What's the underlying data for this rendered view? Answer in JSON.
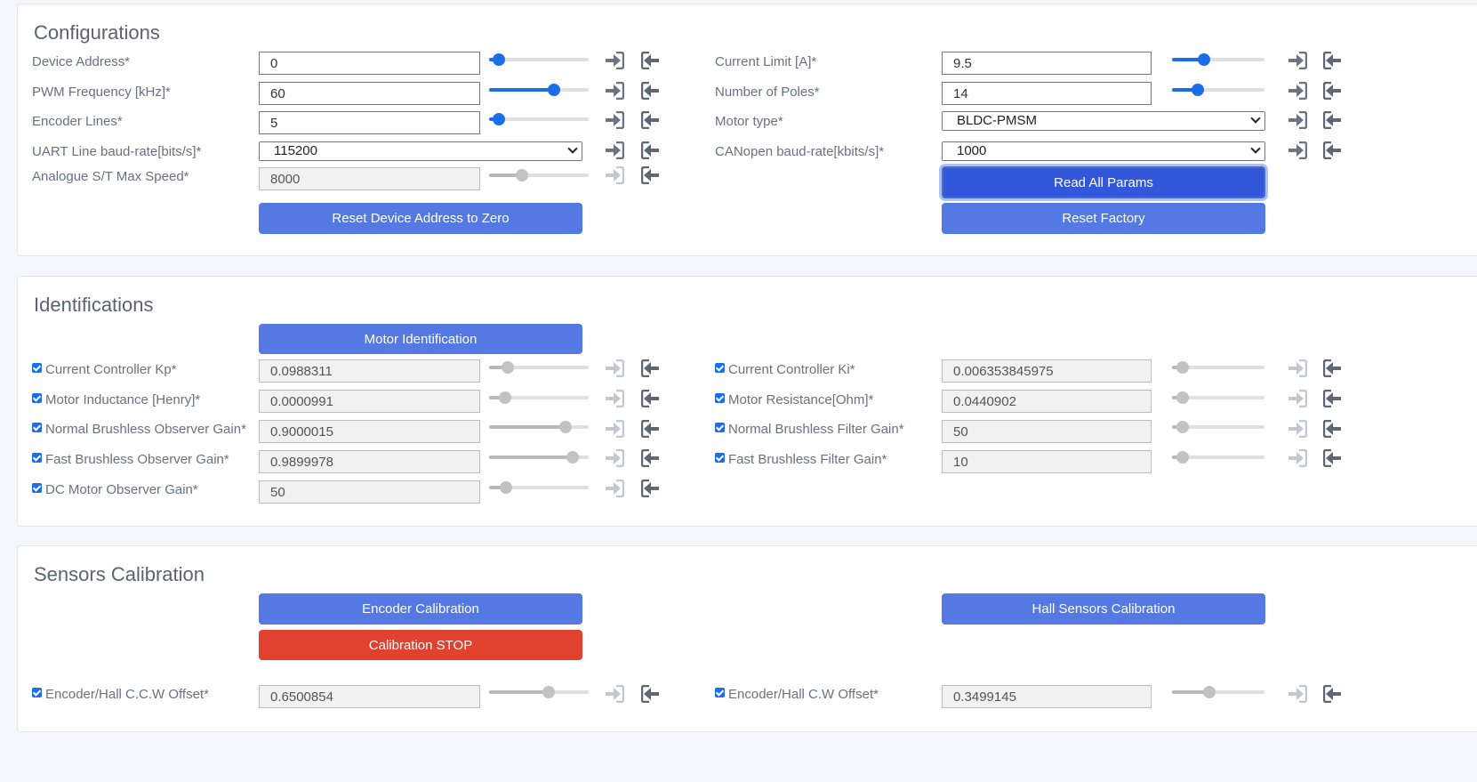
{
  "configurations": {
    "title": "Configurations",
    "device_address": {
      "label": "Device Address*",
      "value": "0",
      "slider": 0.1
    },
    "pwm_frequency": {
      "label": "PWM Frequency [kHz]*",
      "value": "60",
      "slider": 0.65
    },
    "encoder_lines": {
      "label": "Encoder Lines*",
      "value": "5",
      "slider": 0.1
    },
    "uart_baud": {
      "label": "UART Line baud-rate[bits/s]*",
      "value": "115200"
    },
    "analogue_max_speed": {
      "label": "Analogue S/T Max Speed*",
      "value": "8000",
      "slider": 0.33
    },
    "current_limit": {
      "label": "Current Limit [A]*",
      "value": "9.5",
      "slider": 0.35
    },
    "number_of_poles": {
      "label": "Number of Poles*",
      "value": "14",
      "slider": 0.28
    },
    "motor_type": {
      "label": "Motor type*",
      "value": "BLDC-PMSM"
    },
    "canopen_baud": {
      "label": "CANopen baud-rate[kbits/s]*",
      "value": "1000"
    },
    "reset_device_address_label": "Reset Device Address to Zero",
    "read_all_params_label": "Read All Params",
    "reset_factory_label": "Reset Factory"
  },
  "identifications": {
    "title": "Identifications",
    "motor_identification_label": "Motor Identification",
    "current_kp": {
      "label": "Current Controller Kp*",
      "value": "0.0988311",
      "slider": 0.19
    },
    "motor_inductance": {
      "label": "Motor Inductance [Henry]*",
      "value": "0.0000991",
      "slider": 0.16
    },
    "normal_observer_gain": {
      "label": "Normal Brushless Observer Gain*",
      "value": "0.9000015",
      "slider": 0.77
    },
    "fast_observer_gain": {
      "label": "Fast Brushless Observer Gain*",
      "value": "0.9899978",
      "slider": 0.84
    },
    "dc_observer_gain": {
      "label": "DC Motor Observer Gain*",
      "value": "50",
      "slider": 0.17
    },
    "current_ki": {
      "label": "Current Controller Ki*",
      "value": "0.006353845975",
      "slider": 0.12
    },
    "motor_resistance": {
      "label": "Motor Resistance[Ohm]*",
      "value": "0.0440902",
      "slider": 0.12
    },
    "normal_filter_gain": {
      "label": "Normal Brushless Filter Gain*",
      "value": "50",
      "slider": 0.12
    },
    "fast_filter_gain": {
      "label": "Fast Brushless Filter Gain*",
      "value": "10",
      "slider": 0.12
    }
  },
  "sensors": {
    "title": "Sensors Calibration",
    "encoder_calibration_label": "Encoder Calibration",
    "calibration_stop_label": "Calibration STOP",
    "hall_calibration_label": "Hall Sensors Calibration",
    "ccw_offset": {
      "label": "Encoder/Hall C.C.W Offset*",
      "value": "0.6500854",
      "slider": 0.6
    },
    "cw_offset": {
      "label": "Encoder/Hall C.W Offset*",
      "value": "0.3499145",
      "slider": 0.4
    }
  },
  "colors": {
    "accent": "#5479e3",
    "focus": "#3357db",
    "danger": "#e0422f",
    "slider": "#1b6ee8"
  },
  "icons": {
    "write": "sign-in-icon",
    "read": "sign-out-icon"
  }
}
